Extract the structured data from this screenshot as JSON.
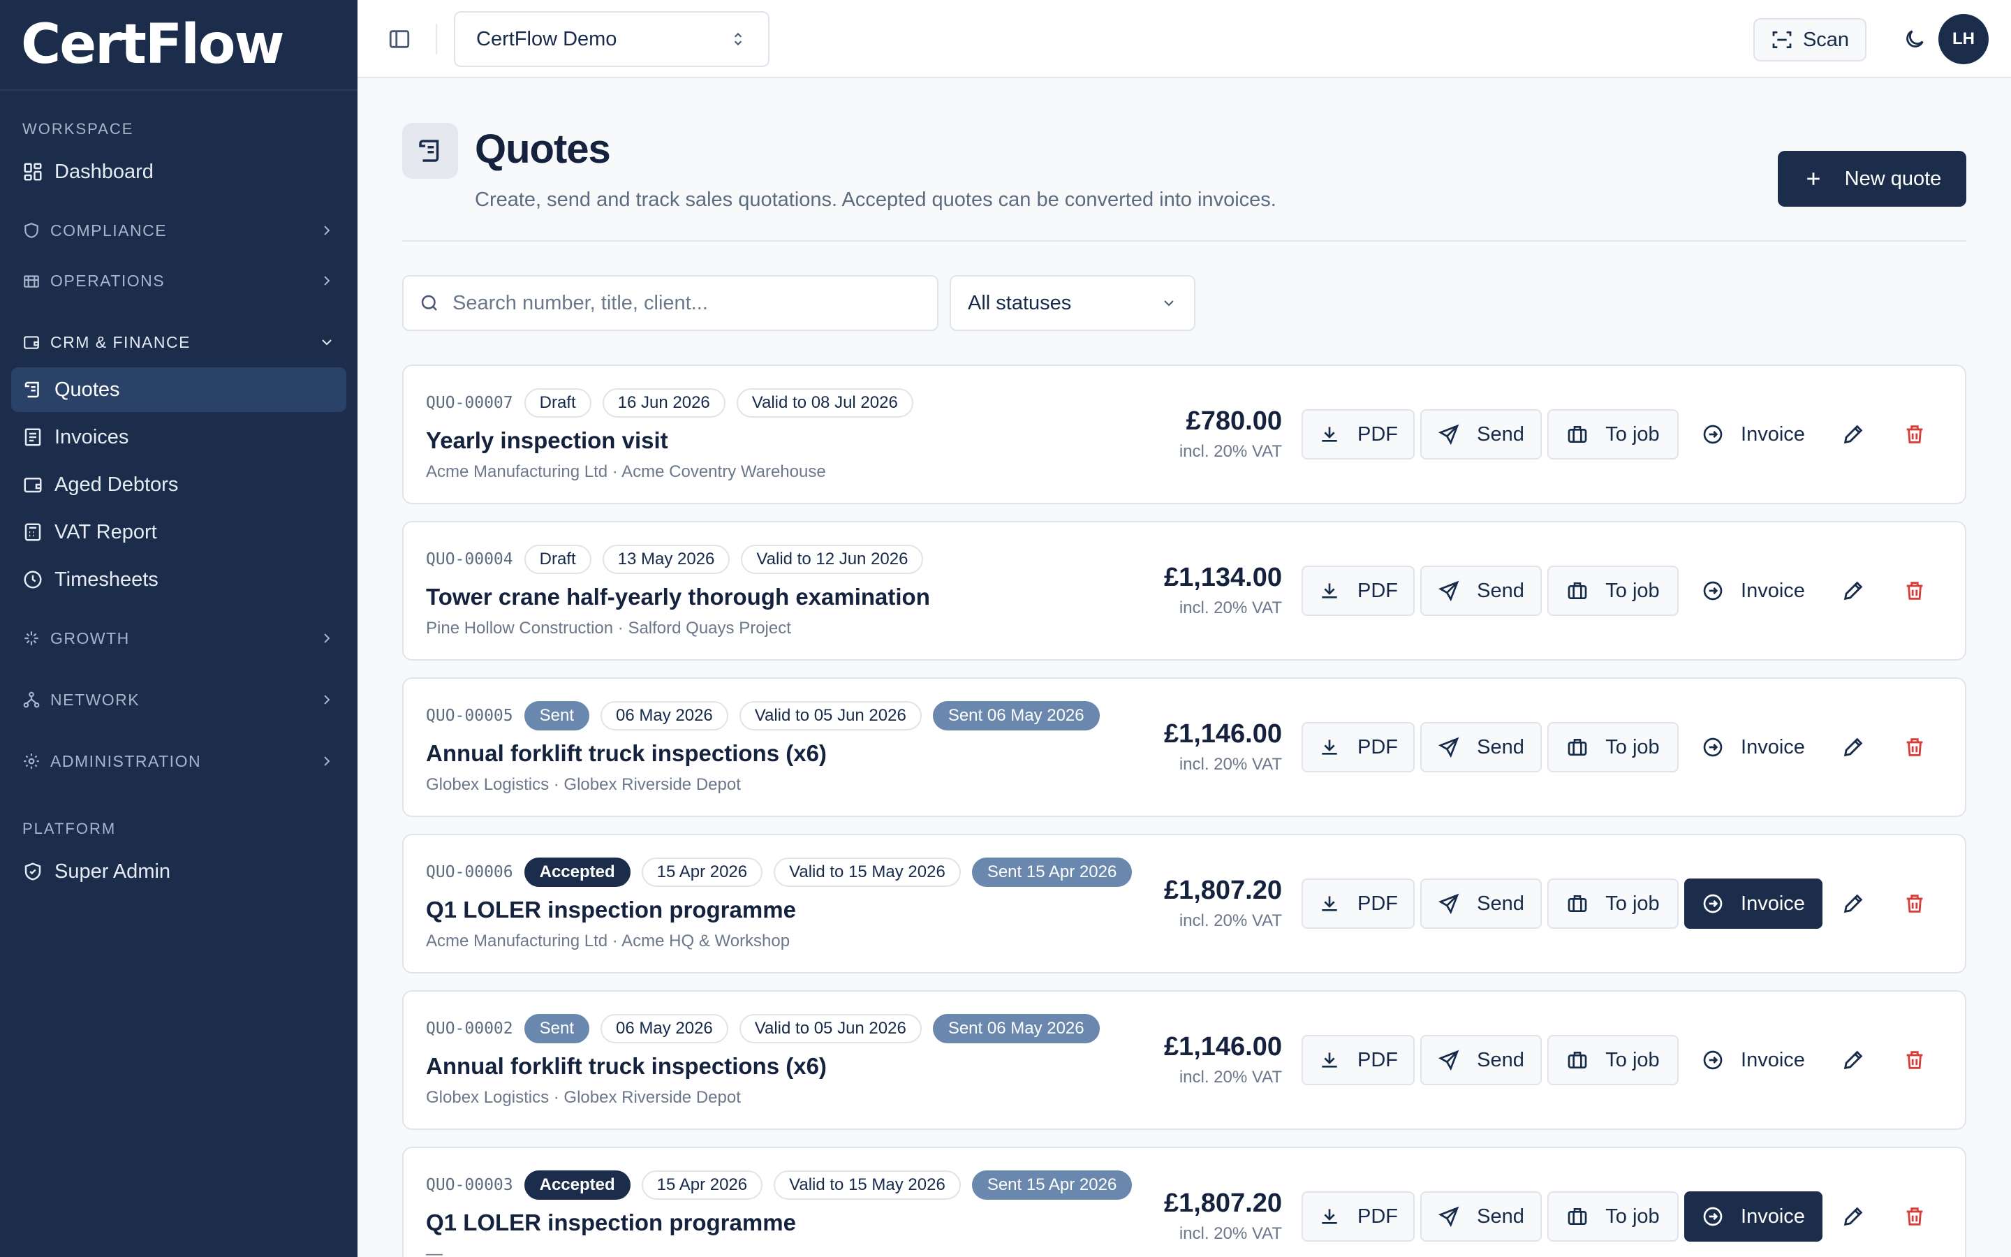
{
  "app": {
    "brand": "CertFlow",
    "workspace": "CertFlow Demo",
    "scan_label": "Scan",
    "avatar_initials": "LH"
  },
  "sidebar": {
    "sections": {
      "workspace": "WORKSPACE",
      "platform": "PLATFORM"
    },
    "dashboard": "Dashboard",
    "groups": {
      "compliance": "COMPLIANCE",
      "operations": "OPERATIONS",
      "crm": "CRM & FINANCE",
      "growth": "GROWTH",
      "network": "NETWORK",
      "administration": "ADMINISTRATION"
    },
    "crm_items": [
      "Quotes",
      "Invoices",
      "Aged Debtors",
      "VAT Report",
      "Timesheets"
    ],
    "super_admin": "Super Admin"
  },
  "page": {
    "title": "Quotes",
    "subtitle": "Create, send and track sales quotations. Accepted quotes can be converted into invoices.",
    "new_quote": "New quote"
  },
  "filters": {
    "search_placeholder": "Search number, title, client...",
    "status_value": "All statuses"
  },
  "actions": {
    "pdf": "PDF",
    "send": "Send",
    "to_job": "To job",
    "invoice": "Invoice"
  },
  "quotes": [
    {
      "number": "QUO-00007",
      "status": "Draft",
      "date": "16 Jun 2026",
      "valid": "Valid to 08 Jul 2026",
      "sent": "",
      "title": "Yearly inspection visit",
      "client": "Acme Manufacturing Ltd · Acme Coventry Warehouse",
      "amount": "£780.00",
      "vat": "incl. 20% VAT"
    },
    {
      "number": "QUO-00004",
      "status": "Draft",
      "date": "13 May 2026",
      "valid": "Valid to 12 Jun 2026",
      "sent": "",
      "title": "Tower crane half-yearly thorough examination",
      "client": "Pine Hollow Construction · Salford Quays Project",
      "amount": "£1,134.00",
      "vat": "incl. 20% VAT"
    },
    {
      "number": "QUO-00005",
      "status": "Sent",
      "date": "06 May 2026",
      "valid": "Valid to 05 Jun 2026",
      "sent": "Sent 06 May 2026",
      "title": "Annual forklift truck inspections (x6)",
      "client": "Globex Logistics · Globex Riverside Depot",
      "amount": "£1,146.00",
      "vat": "incl. 20% VAT"
    },
    {
      "number": "QUO-00006",
      "status": "Accepted",
      "date": "15 Apr 2026",
      "valid": "Valid to 15 May 2026",
      "sent": "Sent 15 Apr 2026",
      "title": "Q1 LOLER inspection programme",
      "client": "Acme Manufacturing Ltd · Acme HQ & Workshop",
      "amount": "£1,807.20",
      "vat": "incl. 20% VAT"
    },
    {
      "number": "QUO-00002",
      "status": "Sent",
      "date": "06 May 2026",
      "valid": "Valid to 05 Jun 2026",
      "sent": "Sent 06 May 2026",
      "title": "Annual forklift truck inspections (x6)",
      "client": "Globex Logistics · Globex Riverside Depot",
      "amount": "£1,146.00",
      "vat": "incl. 20% VAT"
    },
    {
      "number": "QUO-00003",
      "status": "Accepted",
      "date": "15 Apr 2026",
      "valid": "Valid to 15 May 2026",
      "sent": "Sent 15 Apr 2026",
      "title": "Q1 LOLER inspection programme",
      "client": "—",
      "amount": "£1,807.20",
      "vat": "incl. 20% VAT"
    }
  ],
  "colors": {
    "sidebar_bg": "#1b2d4b",
    "primary": "#1b2d4b",
    "sent_badge": "#6a87ad",
    "danger": "#d93a3a",
    "page_bg": "#f7f9fb"
  }
}
